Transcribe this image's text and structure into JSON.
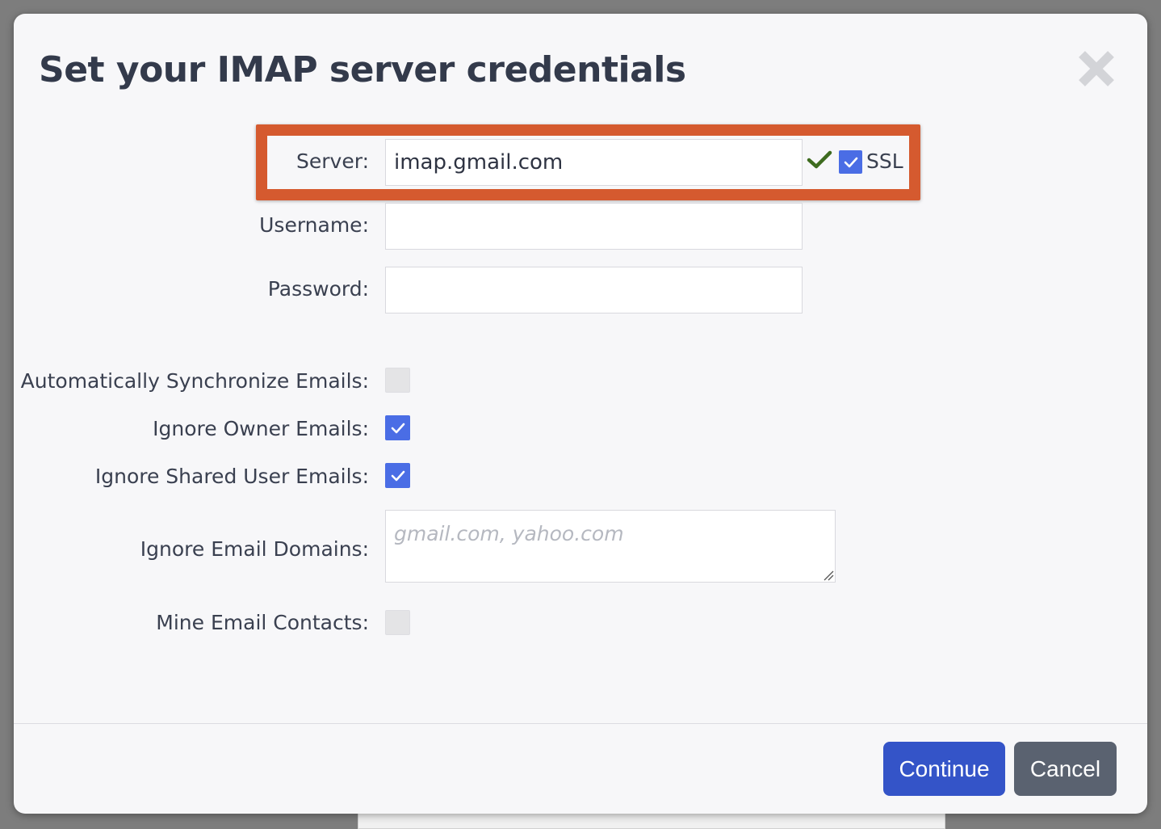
{
  "dialog": {
    "title": "Set your IMAP server credentials"
  },
  "form": {
    "server": {
      "label": "Server:",
      "value": "imap.gmail.com",
      "valid": true
    },
    "ssl": {
      "label": "SSL",
      "checked": true
    },
    "username": {
      "label": "Username:",
      "value": ""
    },
    "password": {
      "label": "Password:",
      "value": ""
    },
    "auto_sync": {
      "label": "Automatically Synchronize Emails:",
      "checked": false
    },
    "ignore_owner": {
      "label": "Ignore Owner Emails:",
      "checked": true
    },
    "ignore_shared": {
      "label": "Ignore Shared User Emails:",
      "checked": true
    },
    "ignore_domains": {
      "label": "Ignore Email Domains:",
      "value": "",
      "placeholder": "gmail.com, yahoo.com"
    },
    "mine_contacts": {
      "label": "Mine Email Contacts:",
      "checked": false
    }
  },
  "footer": {
    "continue_label": "Continue",
    "cancel_label": "Cancel"
  },
  "colors": {
    "accent": "#4a6de5",
    "primary_button": "#3454c8",
    "secondary_button": "#5a6270",
    "highlight_border": "#d55a2f",
    "valid_check": "#3e6b1f"
  }
}
